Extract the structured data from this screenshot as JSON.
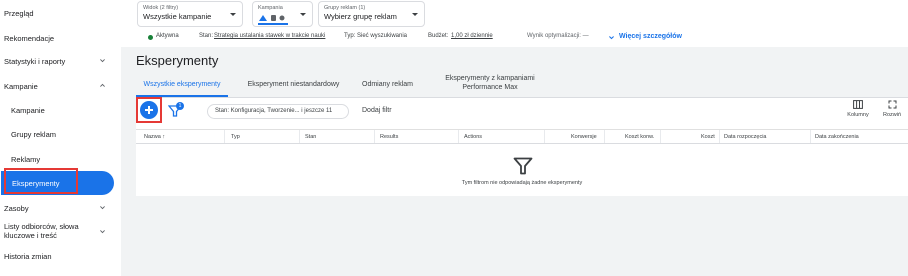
{
  "sidebar": {
    "items": [
      {
        "label": "Przegląd"
      },
      {
        "label": "Rekomendacje"
      },
      {
        "label": "Statystyki i raporty"
      },
      {
        "label": "Kampanie"
      },
      {
        "label": "Kampanie"
      },
      {
        "label": "Grupy reklam"
      },
      {
        "label": "Reklamy"
      },
      {
        "label": "Eksperymenty"
      },
      {
        "label": "Zasoby"
      },
      {
        "label": "Listy odbiorców, słowa kluczowe i treść"
      },
      {
        "label": "Historia zmian"
      }
    ]
  },
  "topbar": {
    "view_chip": {
      "caption": "Widok (2 filtry)",
      "value": "Wszystkie kampanie"
    },
    "campaign_chip": {
      "caption": "Kampania"
    },
    "adgroup_chip": {
      "caption": "Grupy reklam (1)",
      "value": "Wybierz grupę reklam"
    },
    "status": "Aktywna",
    "bid_label": "Stan:",
    "bid_value": "Strategia ustalania stawek w trakcie nauki",
    "type_label": "Typ:",
    "type_value": "Sieć wyszukiwania",
    "budget_label": "Budżet:",
    "budget_value": "1,00 zł dziennie",
    "optimization": "Wynik optymalizacji: —",
    "more_details": "Więcej szczegółów"
  },
  "page": {
    "title": "Eksperymenty"
  },
  "tabs": [
    {
      "label": "Wszystkie eksperymenty"
    },
    {
      "label": "Eksperyment niestandardowy"
    },
    {
      "label": "Odmiany reklam"
    },
    {
      "label": "Eksperymenty z kampaniami Performance Max"
    }
  ],
  "toolbar": {
    "filter_badge": "1",
    "filter_chip": "Stan: Konfiguracja, Tworzenie... i jeszcze 11",
    "add_filter": "Dodaj filtr",
    "columns": "Kolumny",
    "expand": "Rozwiń"
  },
  "table": {
    "headers": [
      "Nazwa",
      "Typ",
      "Stan",
      "Results",
      "Actions",
      "Konwersje",
      "Koszt konw.",
      "Koszt",
      "Data rozpoczęcia",
      "Data zakończenia"
    ],
    "empty_message": "Tym filtrom nie odpowiadają żadne eksperymenty"
  },
  "colors": {
    "accent": "#1a73e8",
    "highlight": "#e53935",
    "status_green": "#188038"
  }
}
